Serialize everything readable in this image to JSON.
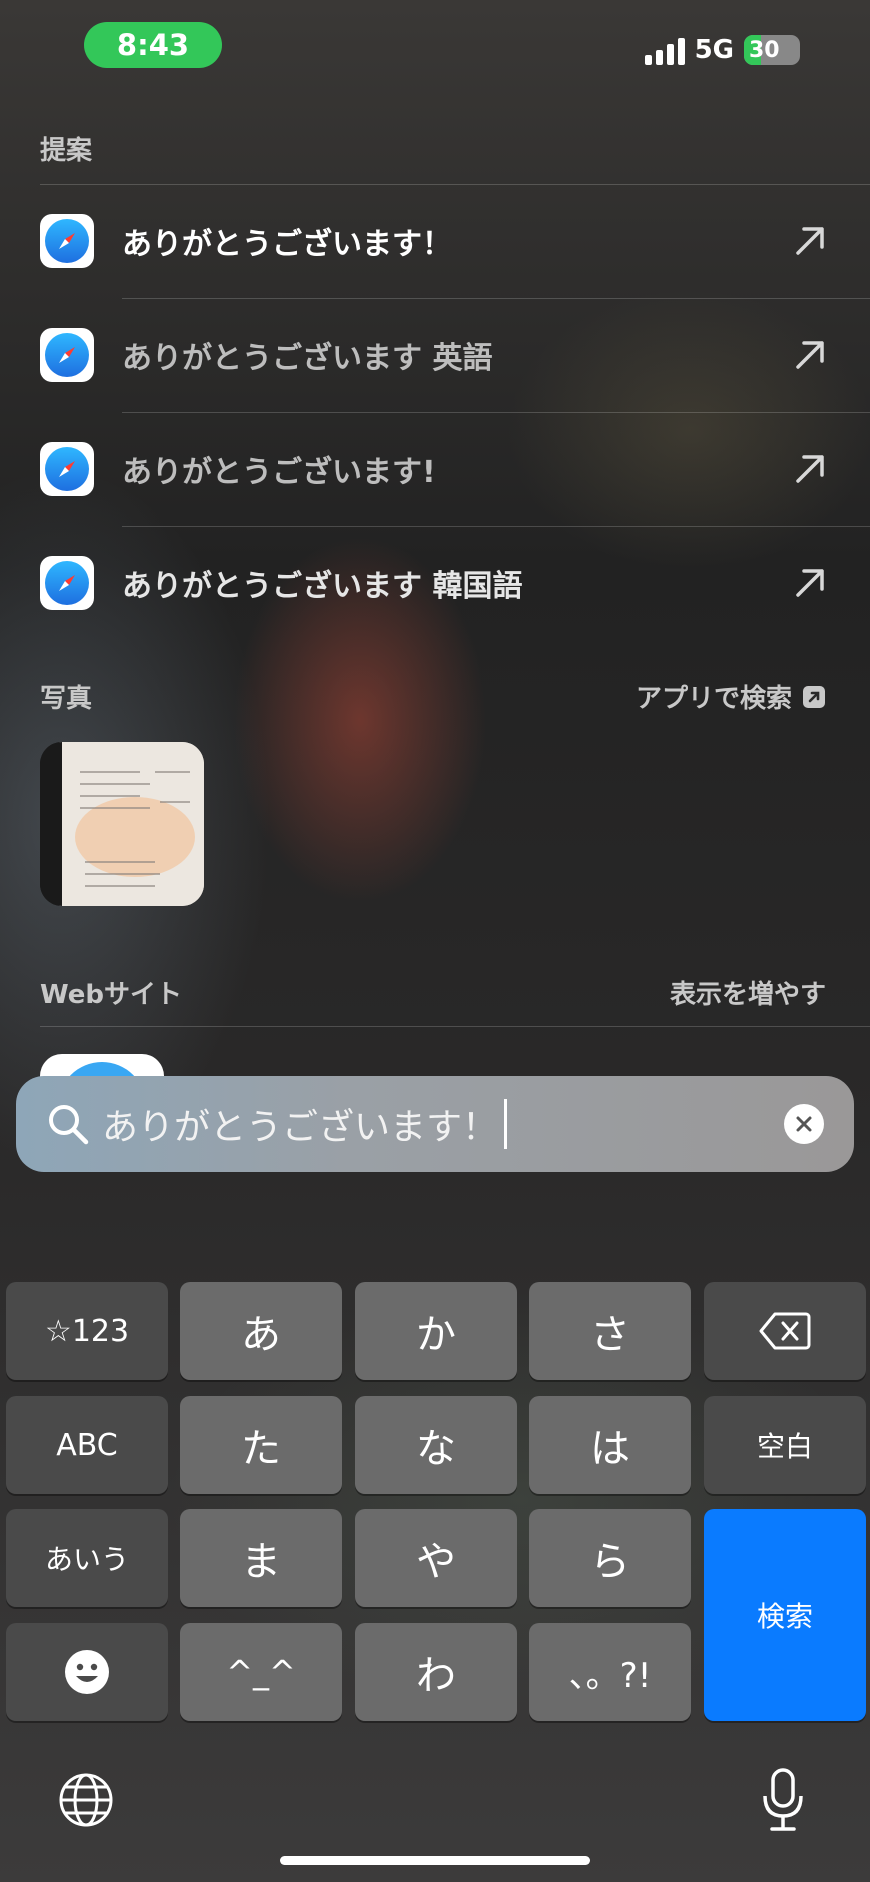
{
  "status": {
    "time": "8:43",
    "network": "5G",
    "battery_level": "30"
  },
  "suggestions": {
    "title": "提案",
    "items": [
      {
        "label": "ありがとうございます！",
        "emphasis": true
      },
      {
        "label": "ありがとうございます 英語",
        "emphasis": false
      },
      {
        "label": "ありがとうございます!",
        "emphasis": false
      },
      {
        "label": "ありがとうございます 韓国語",
        "emphasis": true
      }
    ]
  },
  "photos": {
    "title": "写真",
    "search_in_app": "アプリで検索"
  },
  "websites": {
    "title": "Webサイト",
    "show_more": "表示を増やす"
  },
  "search": {
    "query": "ありがとうございます！"
  },
  "keyboard": {
    "keys": [
      "☆123",
      "あ",
      "か",
      "さ",
      "ABC",
      "た",
      "な",
      "は",
      "空白",
      "あいう",
      "ま",
      "や",
      "ら",
      "^_^",
      "わ",
      "、。?!"
    ],
    "search_key": "検索"
  },
  "colors": {
    "status_green": "#33c759",
    "accent_blue": "#0a7bff"
  }
}
